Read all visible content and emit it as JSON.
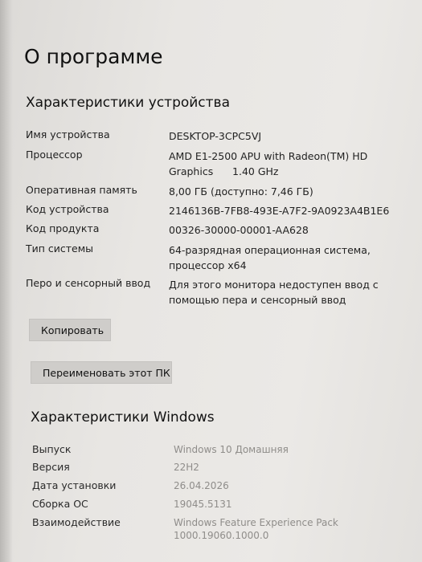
{
  "page": {
    "title": "О программе"
  },
  "device_specs": {
    "heading": "Характеристики устройства",
    "rows": [
      {
        "label": "Имя устройства",
        "value_lines": [
          "DESKTOP-3CPC5VJ"
        ]
      },
      {
        "label": "Процессор",
        "value_lines": [
          "AMD E1-2500 APU with Radeon(TM) HD",
          "Graphics      1.40 GHz"
        ]
      },
      {
        "label": "Оперативная память",
        "value_lines": [
          "8,00 ГБ (доступно: 7,46 ГБ)"
        ]
      },
      {
        "label": "Код устройства",
        "value_lines": [
          "2146136B-7FB8-493E-A7F2-9A0923A4B1E6"
        ]
      },
      {
        "label": "Код продукта",
        "value_lines": [
          "00326-30000-00001-AA628"
        ]
      },
      {
        "label": "Тип системы",
        "value_lines": [
          "64-разрядная операционная система,",
          "процессор x64"
        ]
      },
      {
        "label": "Перо и сенсорный ввод",
        "value_lines": [
          "Для этого монитора недоступен ввод с",
          "помощью пера и сенсорный ввод"
        ]
      }
    ],
    "copy_button": "Копировать",
    "rename_button": "Переименовать этот ПК"
  },
  "windows_specs": {
    "heading": "Характеристики Windows",
    "rows": [
      {
        "label": "Выпуск",
        "value_lines": [
          "Windows 10 Домашняя"
        ]
      },
      {
        "label": "Версия",
        "value_lines": [
          "22H2"
        ]
      },
      {
        "label": "Дата установки",
        "value_lines": [
          "26.04.2026"
        ]
      },
      {
        "label": "Сборка ОС",
        "value_lines": [
          "19045.5131"
        ]
      },
      {
        "label": "Взаимодействие",
        "value_lines": [
          "Windows Feature Experience Pack",
          "1000.19060.1000.0"
        ]
      }
    ]
  }
}
